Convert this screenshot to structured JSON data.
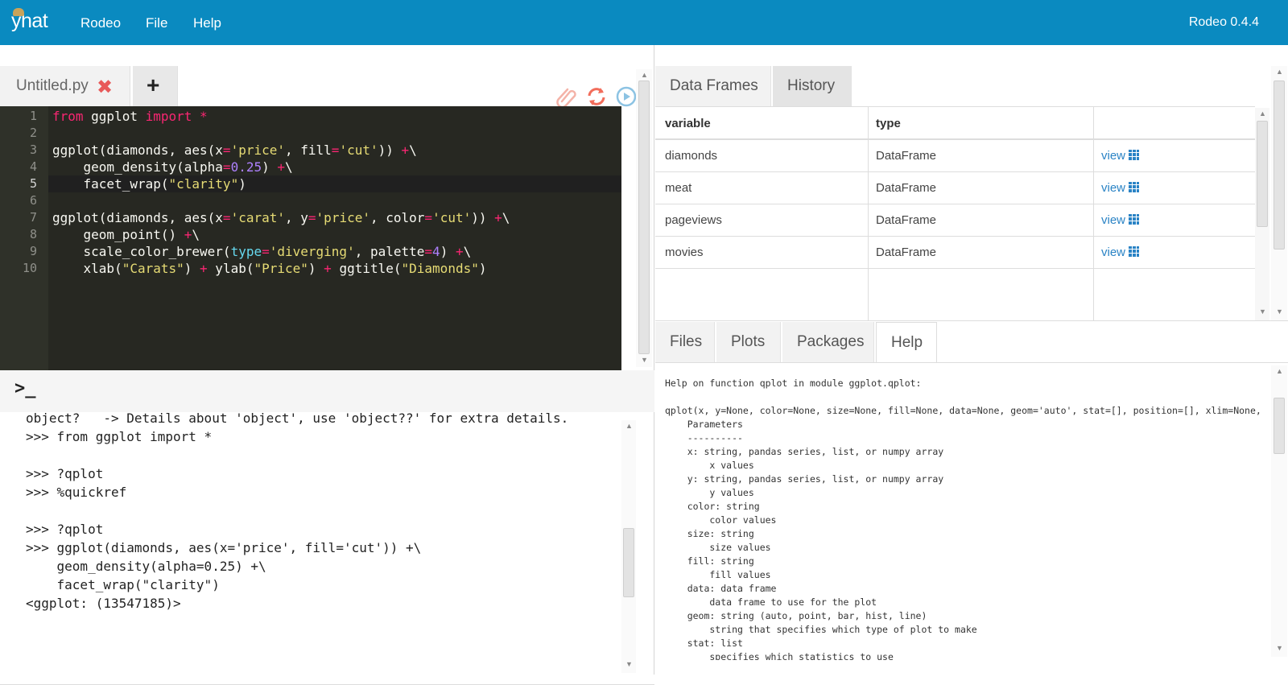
{
  "topbar": {
    "logo": "yhat",
    "menu": [
      "Rodeo",
      "File",
      "Help"
    ],
    "version": "Rodeo 0.4.4",
    "color": "#0a8ac0"
  },
  "editor": {
    "tab_name": "Untitled.py",
    "close_icon": "close-icon",
    "add_label": "+",
    "toolbar_icons": [
      "paperclip-icon",
      "refresh-icon",
      "run-icon"
    ],
    "line_numbers": [
      "1",
      "2",
      "3",
      "4",
      "5",
      "6",
      "7",
      "8",
      "9",
      "10"
    ]
  },
  "console": {
    "prompt_symbol": ">_",
    "lines": [
      "object?   -> Details about 'object', use 'object??' for extra details.",
      ">>> from ggplot import *",
      "",
      ">>> ?qplot",
      ">>> %quickref",
      "",
      ">>> ?qplot",
      ">>> ggplot(diamonds, aes(x='price', fill='cut')) +\\",
      "    geom_density(alpha=0.25) +\\",
      "    facet_wrap(\"clarity\")",
      "<ggplot: (13547185)>"
    ]
  },
  "dataframes": {
    "tabs": [
      "Data Frames",
      "History"
    ],
    "columns": [
      "variable",
      "type",
      ""
    ],
    "rows": [
      {
        "variable": "diamonds",
        "type": "DataFrame",
        "action": "view"
      },
      {
        "variable": "meat",
        "type": "DataFrame",
        "action": "view"
      },
      {
        "variable": "pageviews",
        "type": "DataFrame",
        "action": "view"
      },
      {
        "variable": "movies",
        "type": "DataFrame",
        "action": "view"
      }
    ]
  },
  "bottom_tabs": [
    "Files",
    "Plots",
    "Packages",
    "Help"
  ],
  "help": {
    "lines": [
      "Help on function qplot in module ggplot.qplot:",
      "",
      "qplot(x, y=None, color=None, size=None, fill=None, data=None, geom='auto', stat=[], position=[], xlim=None, ylim",
      "    Parameters",
      "    ----------",
      "    x: string, pandas series, list, or numpy array",
      "        x values",
      "    y: string, pandas series, list, or numpy array",
      "        y values",
      "    color: string",
      "        color values",
      "    size: string",
      "        size values",
      "    fill: string",
      "        fill values",
      "    data: data frame",
      "        data frame to use for the plot",
      "    geom: string (auto, point, bar, hist, line)",
      "        string that specifies which type of plot to make",
      "    stat: list",
      "        specifies which statistics to use"
    ]
  }
}
